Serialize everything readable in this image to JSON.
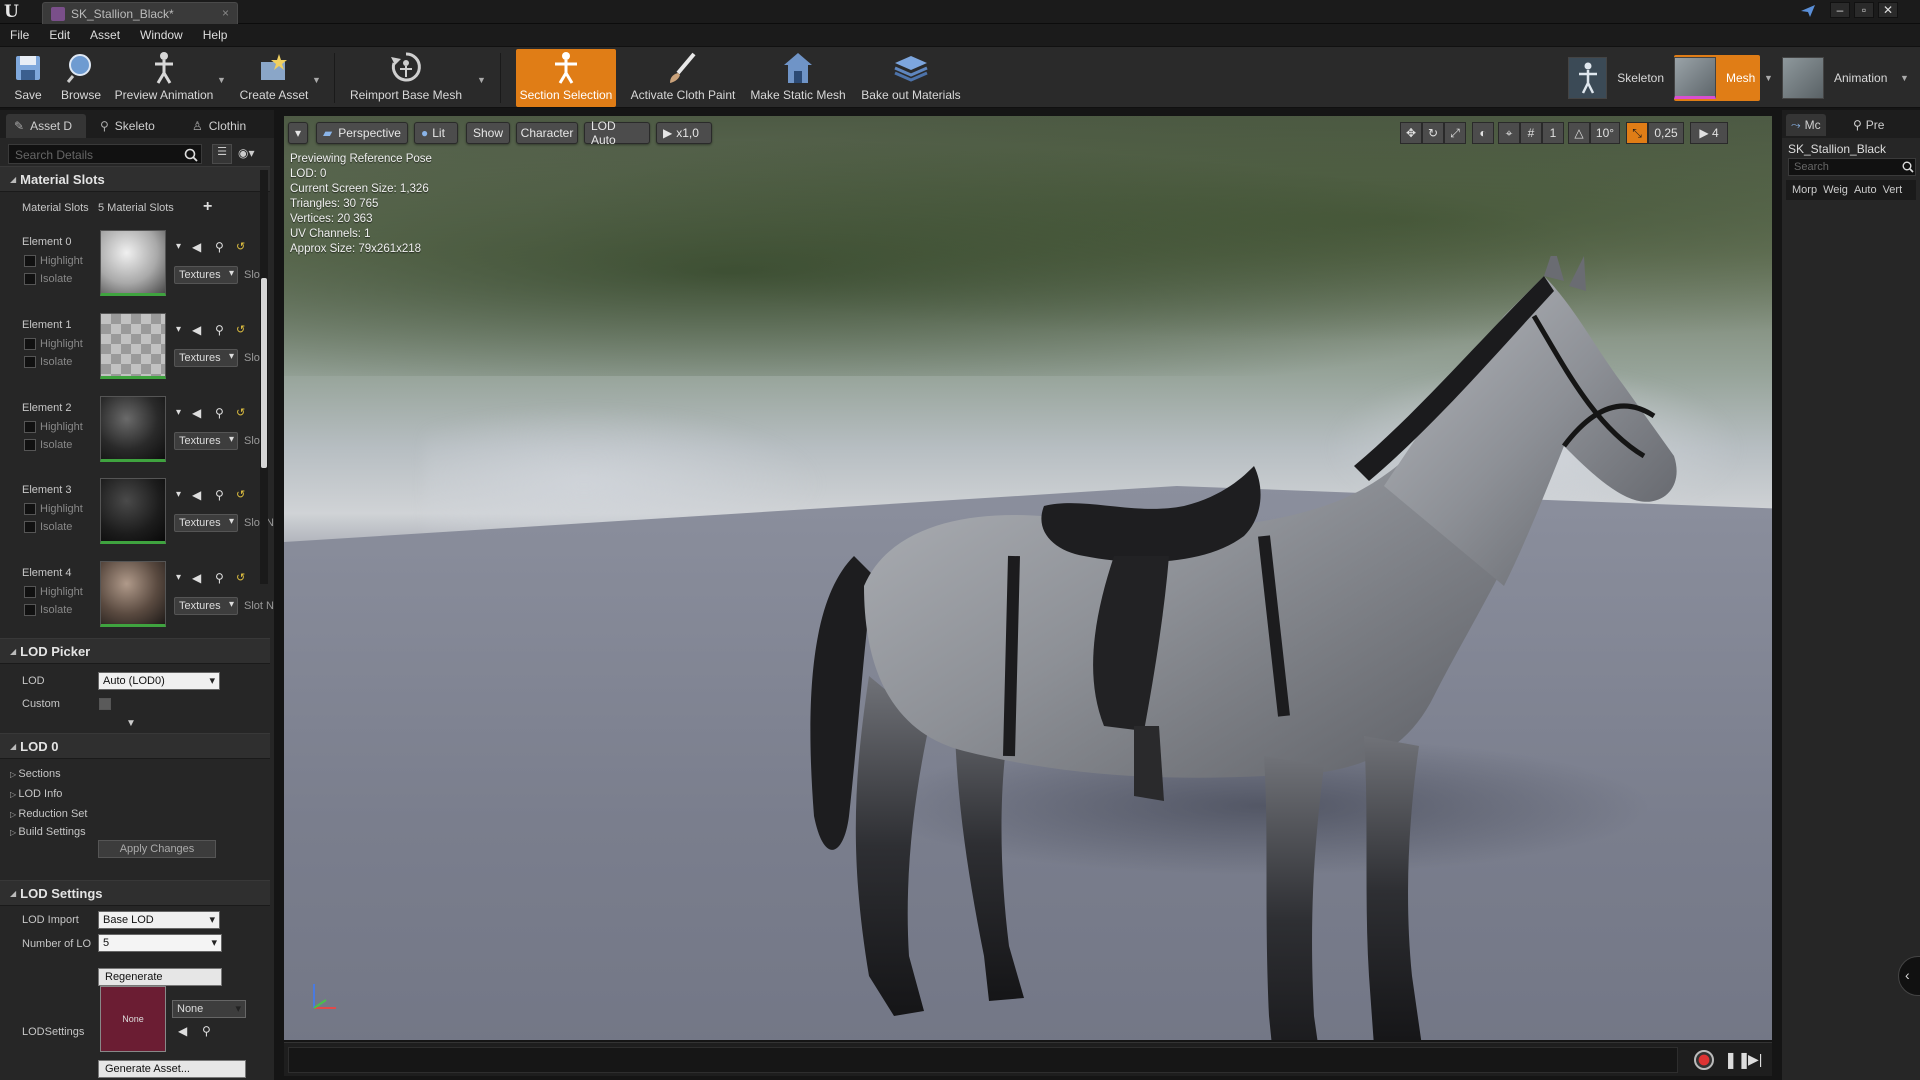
{
  "window": {
    "tab_title": "SK_Stallion_Black*",
    "close_glyph": "×"
  },
  "menu": [
    "File",
    "Edit",
    "Asset",
    "Window",
    "Help"
  ],
  "toolbar": {
    "save": "Save",
    "browse": "Browse",
    "preview_animation": "Preview Animation",
    "create_asset": "Create Asset",
    "reimport_base_mesh": "Reimport Base Mesh",
    "section_selection": "Section Selection",
    "activate_cloth_paint": "Activate Cloth Paint",
    "make_static_mesh": "Make Static Mesh",
    "bake_out_materials": "Bake out Materials",
    "mode_skeleton": "Skeleton",
    "mode_mesh": "Mesh",
    "mode_animation": "Animation",
    "accent_color": "#e07d16"
  },
  "left_panel": {
    "tabs": [
      "Asset D",
      "Skeleto",
      "Clothin"
    ],
    "search_placeholder": "Search Details",
    "material_slots": {
      "header": "Material Slots",
      "label": "Material Slots",
      "count": "5 Material Slots",
      "elements": [
        {
          "name": "Element 0",
          "highlight": "Highlight",
          "isolate": "Isolate",
          "textures": "Textures",
          "slot": "Slo"
        },
        {
          "name": "Element 1",
          "highlight": "Highlight",
          "isolate": "Isolate",
          "textures": "Textures",
          "slot": "Slo"
        },
        {
          "name": "Element 2",
          "highlight": "Highlight",
          "isolate": "Isolate",
          "textures": "Textures",
          "slot": "Slo"
        },
        {
          "name": "Element 3",
          "highlight": "Highlight",
          "isolate": "Isolate",
          "textures": "Textures",
          "slot": "Slot N"
        },
        {
          "name": "Element 4",
          "highlight": "Highlight",
          "isolate": "Isolate",
          "textures": "Textures",
          "slot": "Slot N"
        }
      ]
    },
    "lod_picker": {
      "header": "LOD Picker",
      "lod_label": "LOD",
      "lod_value": "Auto (LOD0)",
      "custom_label": "Custom"
    },
    "lod0": {
      "header": "LOD 0",
      "items": [
        "Sections",
        "LOD Info",
        "Reduction Set",
        "Build Settings"
      ],
      "apply_changes": "Apply Changes"
    },
    "lod_settings": {
      "header": "LOD Settings",
      "lod_import_label": "LOD Import",
      "lod_import_value": "Base LOD",
      "number_of_lod_label": "Number of LO",
      "number_of_lod_value": "5",
      "regenerate": "Regenerate",
      "lodsettings_label": "LODSettings",
      "lodsettings_thumb": "None",
      "lodsettings_value": "None",
      "generate_asset": "Generate Asset..."
    }
  },
  "viewport": {
    "menu_glyph": "▾",
    "perspective": "Perspective",
    "lit": "Lit",
    "show": "Show",
    "character": "Character",
    "lod_auto": "LOD Auto",
    "playback": "x1,0",
    "grid_snap": "1",
    "rotation_snap": "10°",
    "scale_snap": "0,25",
    "camera_speed": "4",
    "stats": [
      "Previewing Reference Pose",
      "LOD: 0",
      "Current Screen Size: 1,326",
      "Triangles: 30 765",
      "Vertices: 20 363",
      "UV Channels: 1",
      "Approx Size: 79x261x218"
    ]
  },
  "right_panel": {
    "tabs": [
      "Mc",
      "Pre"
    ],
    "asset_name": "SK_Stallion_Black",
    "search_placeholder": "Search",
    "columns": [
      "Morp",
      "Weig",
      "Auto",
      "Vert"
    ]
  }
}
